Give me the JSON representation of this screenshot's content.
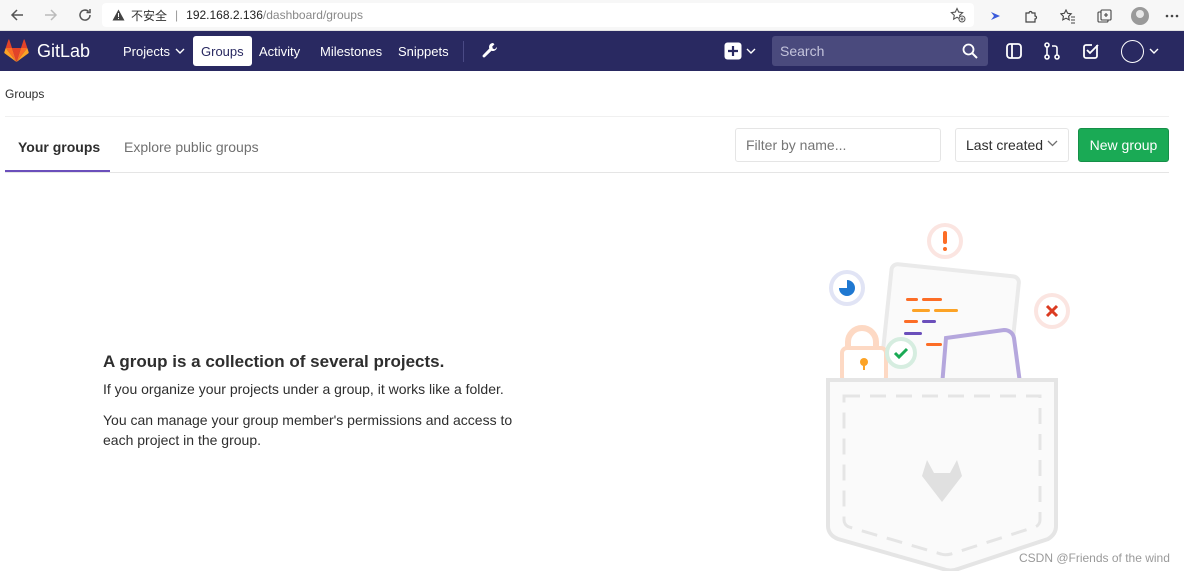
{
  "browser": {
    "insecure_label": "不安全",
    "url_host": "192.168.2.136",
    "url_path": "/dashboard/groups"
  },
  "header": {
    "brand": "GitLab",
    "nav": {
      "projects": "Projects",
      "groups": "Groups",
      "activity": "Activity",
      "milestones": "Milestones",
      "snippets": "Snippets"
    },
    "search_placeholder": "Search",
    "colors": {
      "background": "#292961",
      "search_bg": "#4a4a7d"
    }
  },
  "breadcrumb": "Groups",
  "tabs": {
    "your_groups": "Your groups",
    "explore": "Explore public groups"
  },
  "filter": {
    "placeholder": "Filter by name...",
    "sort_selected": "Last created",
    "new_group": "New group",
    "new_group_color": "#1aaa55"
  },
  "empty_state": {
    "title": "A group is a collection of several projects.",
    "line1": "If you organize your projects under a group, it works like a folder.",
    "line2": "You can manage your group member's permissions and access to each project in the group."
  },
  "watermark": "CSDN @Friends of the wind",
  "accent_color": "#6b4fbb"
}
